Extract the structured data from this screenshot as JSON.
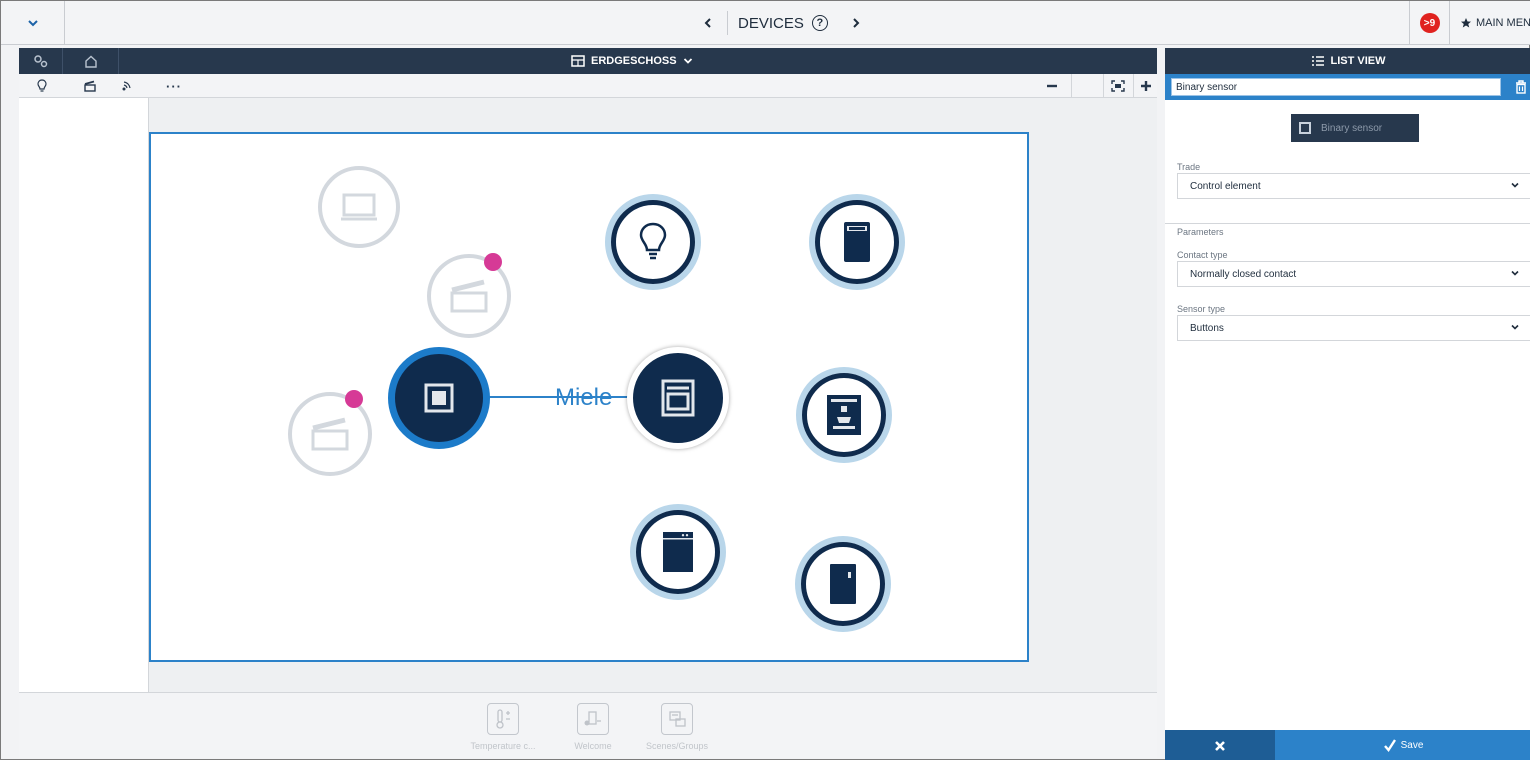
{
  "topbar": {
    "collapse_icon": "chevron-down-icon",
    "prev_icon": "chevron-left-icon",
    "title": "DEVICES",
    "help_icon": "help-circle-icon",
    "next_icon": "chevron-right-icon",
    "notification_count": ">9",
    "main_menu_label": "MAIN MEN"
  },
  "floor": {
    "title": "ERDGESCHOSS",
    "tools": [
      "lightbulb-icon",
      "scene-icon",
      "remote-icon",
      "more-icon"
    ],
    "zoom": {
      "out": "zoom-out-icon",
      "fit": "fit-screen-icon",
      "in": "zoom-in-icon"
    }
  },
  "canvas": {
    "link_label": "Miele",
    "devices": [
      {
        "name": "device-display-faded",
        "icon": "display-icon",
        "state": "faded"
      },
      {
        "name": "device-scene-faded-1",
        "icon": "scene-icon",
        "state": "faded",
        "alert": true
      },
      {
        "name": "device-scene-faded-2",
        "icon": "scene-icon",
        "state": "faded",
        "alert": true
      },
      {
        "name": "device-binary-sensor-selected",
        "icon": "binary-sensor-icon",
        "state": "selected"
      },
      {
        "name": "device-miele-oven",
        "icon": "oven-icon",
        "state": "linked"
      },
      {
        "name": "device-lightbulb",
        "icon": "lightbulb-icon",
        "state": "normal"
      },
      {
        "name": "device-fridge",
        "icon": "fridge-icon",
        "state": "normal"
      },
      {
        "name": "device-coffee-machine",
        "icon": "coffee-machine-icon",
        "state": "normal"
      },
      {
        "name": "device-dishwasher",
        "icon": "dishwasher-icon",
        "state": "normal"
      },
      {
        "name": "device-freezer",
        "icon": "freezer-icon",
        "state": "normal"
      }
    ]
  },
  "bottom_bar": {
    "items": [
      {
        "label": "Temperature c...",
        "icon": "thermometer-icon"
      },
      {
        "label": "Welcome",
        "icon": "welcome-icon"
      },
      {
        "label": "Scenes/Groups",
        "icon": "scenes-icon"
      }
    ]
  },
  "side_panel": {
    "header": "LIST VIEW",
    "name_value": "Binary sensor",
    "type_button": "Binary sensor",
    "trade_label": "Trade",
    "trade_value": "Control element",
    "parameters_label": "Parameters",
    "contact_type_label": "Contact type",
    "contact_type_value": "Normally closed contact",
    "sensor_type_label": "Sensor type",
    "sensor_type_value": "Buttons",
    "save_label": "Save"
  },
  "colors": {
    "navy": "#27384d",
    "accent": "#2c82c9",
    "alert": "#d63a96",
    "badge": "#e0221f"
  }
}
